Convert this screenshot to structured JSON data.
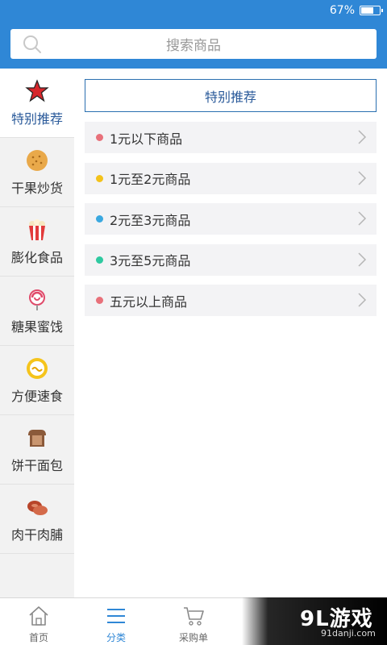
{
  "status_bar": {
    "battery_text": "67%",
    "battery_level": 0.67
  },
  "search": {
    "placeholder": "搜索商品"
  },
  "sidebar": {
    "items": [
      {
        "label": "特别推荐",
        "icon": "star-icon",
        "active": true
      },
      {
        "label": "干果炒货",
        "icon": "biscuit-icon"
      },
      {
        "label": "膨化食品",
        "icon": "popcorn-icon"
      },
      {
        "label": "糖果蜜饯",
        "icon": "lollipop-icon"
      },
      {
        "label": "方便速食",
        "icon": "noodle-bowl-icon"
      },
      {
        "label": "饼干面包",
        "icon": "bread-icon"
      },
      {
        "label": "肉干肉脯",
        "icon": "meat-icon"
      }
    ]
  },
  "content": {
    "section_title": "特别推荐",
    "price_items": [
      {
        "label": "1元以下商品",
        "dot_color": "#e8707a"
      },
      {
        "label": "1元至2元商品",
        "dot_color": "#f3c21a"
      },
      {
        "label": "2元至3元商品",
        "dot_color": "#3aa8e0"
      },
      {
        "label": "3元至5元商品",
        "dot_color": "#2ec9a0"
      },
      {
        "label": "五元以上商品",
        "dot_color": "#e8707a"
      }
    ]
  },
  "tabs": [
    {
      "label": "首页",
      "icon": "home-icon"
    },
    {
      "label": "分类",
      "icon": "list-icon",
      "active": true
    },
    {
      "label": "采购单",
      "icon": "cart-icon"
    }
  ],
  "watermark": {
    "logo": "9L游戏",
    "site": "91danji.com"
  },
  "colors": {
    "brand": "#2f87d6",
    "active_text": "#2a5a9a"
  }
}
